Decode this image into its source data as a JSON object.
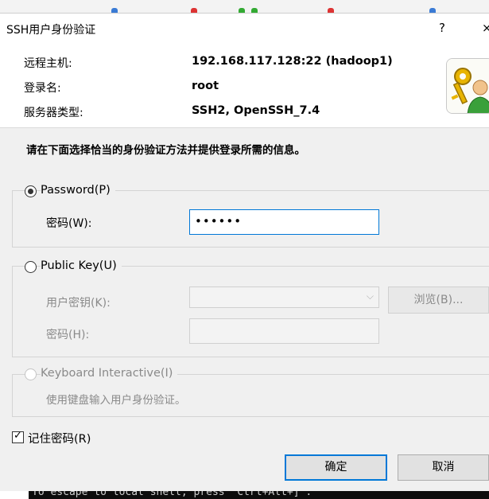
{
  "dialog": {
    "title": "SSH用户身份验证",
    "help_glyph": "?",
    "close_glyph": "×"
  },
  "header": {
    "remote_host_label": "远程主机:",
    "remote_host_value": "192.168.117.128:22 (hadoop1)",
    "login_name_label": "登录名:",
    "login_name_value": "root",
    "server_type_label": "服务器类型:",
    "server_type_value": "SSH2, OpenSSH_7.4",
    "logo_icon": "key-user-icon"
  },
  "instruction": "请在下面选择恰当的身份验证方法并提供登录所需的信息。",
  "password_method": {
    "label": "Password(P)",
    "selected": true,
    "password_label": "密码(W):",
    "password_value": "••••••"
  },
  "public_key_method": {
    "label": "Public Key(U)",
    "selected": false,
    "user_key_label": "用户密钥(K):",
    "user_key_value": "",
    "browse_label": "浏览(B)...",
    "passphrase_label": "密码(H):",
    "passphrase_value": ""
  },
  "keyboard_interactive_method": {
    "label": "Keyboard Interactive(I)",
    "selected": false,
    "hint": "使用键盘输入用户身份验证。"
  },
  "remember_password": {
    "label": "记住密码(R)",
    "checked": true
  },
  "buttons": {
    "ok_label": "确定",
    "cancel_label": "取消"
  },
  "terminal": {
    "text": "To escape to local shell, press 'Ctrl+Alt+]'."
  },
  "colors": {
    "accent": "#0078d7",
    "dialog_bg": "#f0f0f0",
    "terminal_bg": "#0c0c0c"
  }
}
